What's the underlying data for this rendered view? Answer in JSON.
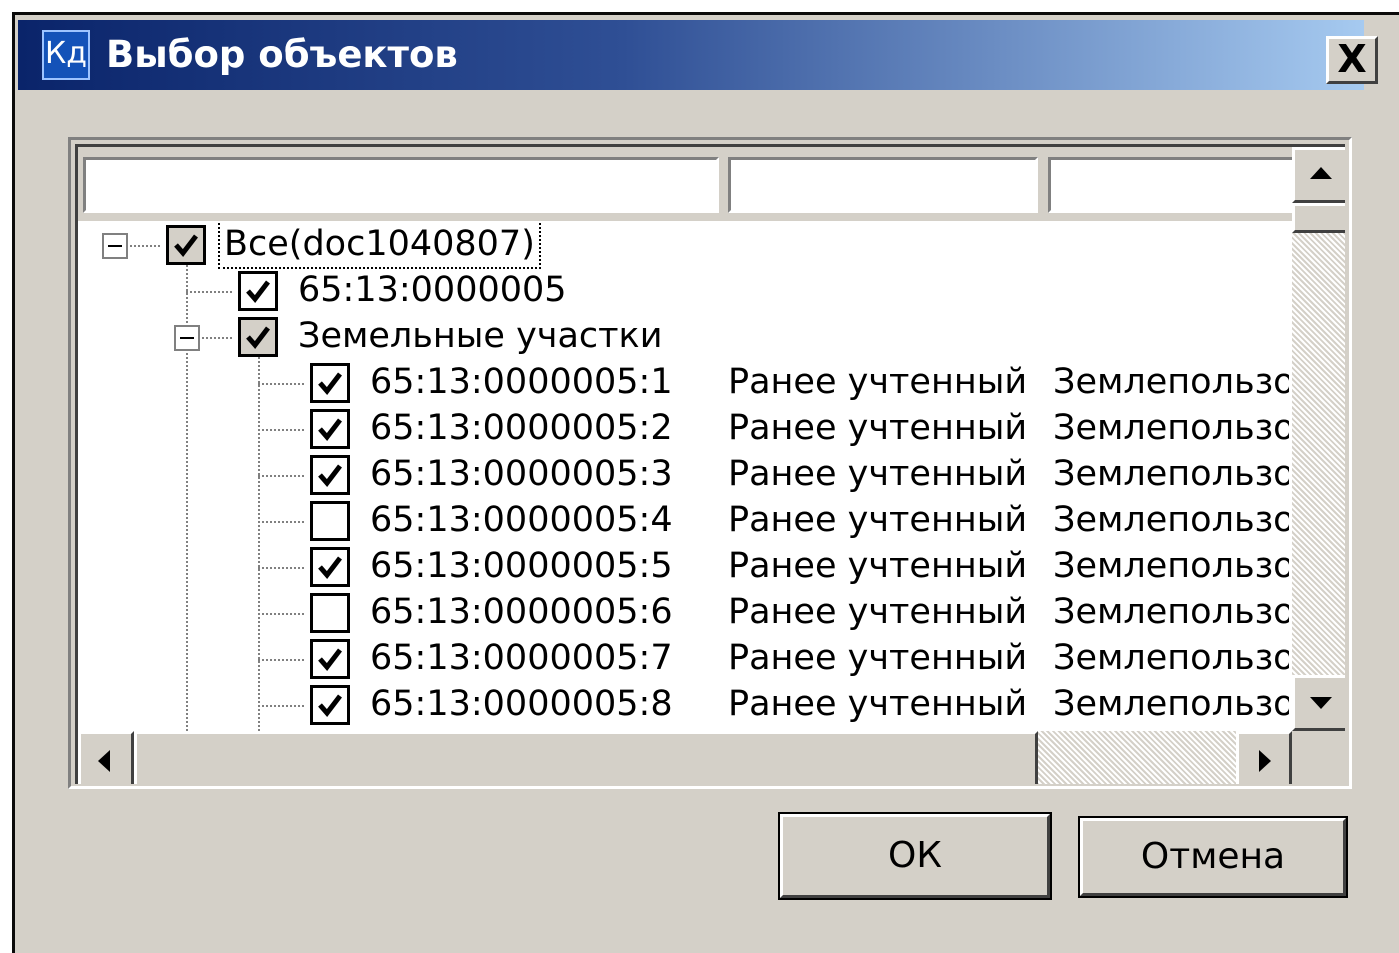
{
  "window": {
    "title": "Выбор объектов",
    "icon_text": "Кд",
    "close_label": "X"
  },
  "tree": {
    "root": {
      "label": "Все(doc1040807)",
      "checked": true,
      "partial": true
    },
    "item1": {
      "label": "65:13:0000005",
      "checked": true
    },
    "group": {
      "label": "Земельные участки",
      "checked": true,
      "partial": true
    },
    "rows": [
      {
        "id": "65:13:0000005:1",
        "status": "Ранее учтенный",
        "type": "Землепользо",
        "checked": true
      },
      {
        "id": "65:13:0000005:2",
        "status": "Ранее учтенный",
        "type": "Землепользо",
        "checked": true
      },
      {
        "id": "65:13:0000005:3",
        "status": "Ранее учтенный",
        "type": "Землепользо",
        "checked": true
      },
      {
        "id": "65:13:0000005:4",
        "status": "Ранее учтенный",
        "type": "Землепользо",
        "checked": false
      },
      {
        "id": "65:13:0000005:5",
        "status": "Ранее учтенный",
        "type": "Землепользо",
        "checked": true
      },
      {
        "id": "65:13:0000005:6",
        "status": "Ранее учтенный",
        "type": "Землепользо",
        "checked": false
      },
      {
        "id": "65:13:0000005:7",
        "status": "Ранее учтенный",
        "type": "Землепользо",
        "checked": true
      },
      {
        "id": "65:13:0000005:8",
        "status": "Ранее учтенный",
        "type": "Землепользо",
        "checked": true
      }
    ]
  },
  "filters": {
    "col1": "",
    "col2": "",
    "col3": ""
  },
  "buttons": {
    "ok": "ОК",
    "cancel": "Отмена"
  },
  "icons": {
    "scroll_up": "up-arrow",
    "scroll_down": "down-arrow",
    "scroll_left": "left-arrow",
    "scroll_right": "right-arrow",
    "check": "check-mark"
  }
}
